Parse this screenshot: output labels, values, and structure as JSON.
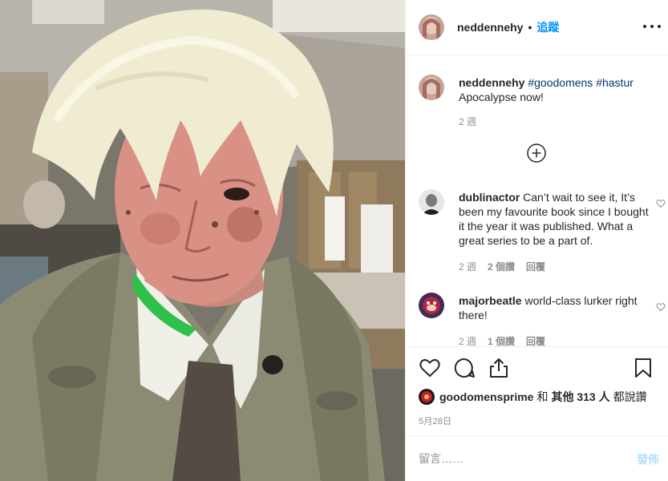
{
  "post": {
    "username": "neddennehy",
    "follow_label": "追蹤",
    "separator": "•",
    "image_alt": "Man with wild white hair, scorched face makeup, green paint on neck, dirty trench coat, in a makeup trailer"
  },
  "caption": {
    "username": "neddennehy",
    "hashtags": "#goodomens #hastur",
    "text": "Apocalypse now!",
    "age": "2 週"
  },
  "comments": [
    {
      "username": "dublinactor",
      "text": "Can’t wait to see it, It’s been my favourite book since I bought it the year it was published. What a great series to be a part of.",
      "age": "2 週",
      "likes": "2 個讚",
      "reply": "回覆"
    },
    {
      "username": "majorbeatle",
      "text": "world-class lurker right there!",
      "age": "2 週",
      "likes": "1 個讚",
      "reply": "回覆"
    }
  ],
  "likes": {
    "first_user": "goodomensprime",
    "connector": "和",
    "others": "其他 313 人",
    "suffix": "都說讚"
  },
  "date": "5月28日",
  "add_comment": {
    "placeholder": "留言……",
    "post_label": "發佈"
  },
  "icons": {
    "more": "more-options-icon",
    "load_more": "plus-circle-icon",
    "like": "heart-icon",
    "comment": "comment-bubble-icon",
    "share": "share-icon",
    "save": "bookmark-icon",
    "comment_like": "small-heart-icon"
  },
  "colors": {
    "link_blue": "#0095f6",
    "hashtag": "#003569",
    "muted": "#8e8e8e",
    "border": "#efefef"
  }
}
